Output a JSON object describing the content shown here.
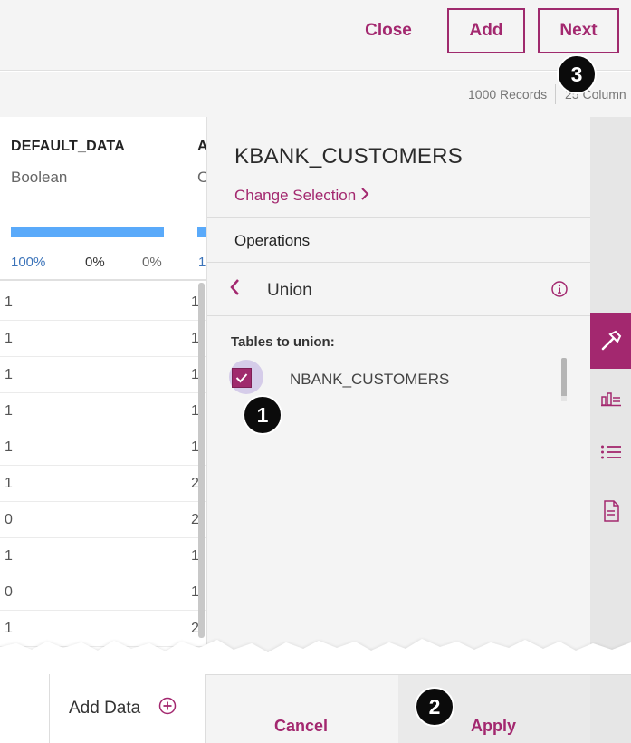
{
  "header": {
    "close_label": "Close",
    "add_label": "Add",
    "next_label": "Next"
  },
  "records_bar": {
    "records": "1000 Records",
    "columns": "25 Column"
  },
  "table": {
    "columns": [
      {
        "name": "DEFAULT_DATA",
        "type": "Boolean"
      },
      {
        "name": "A",
        "type": "C"
      }
    ],
    "stats": [
      "100%",
      "0%",
      "0%",
      "1"
    ],
    "rows": [
      [
        "1",
        "1"
      ],
      [
        "1",
        "1"
      ],
      [
        "1",
        "1"
      ],
      [
        "1",
        "1"
      ],
      [
        "1",
        "1"
      ],
      [
        "1",
        "2"
      ],
      [
        "0",
        "2"
      ],
      [
        "1",
        "1"
      ],
      [
        "0",
        "1"
      ],
      [
        "1",
        "2"
      ]
    ]
  },
  "panel": {
    "title": "KBANK_CUSTOMERS",
    "change_selection": "Change Selection",
    "operations_label": "Operations",
    "operation_name": "Union",
    "tables_label": "Tables to union:",
    "tables": [
      {
        "name": "NBANK_CUSTOMERS",
        "checked": true
      }
    ]
  },
  "sidebar": {
    "icons": [
      "hammer-icon",
      "bar-chart-icon",
      "list-icon",
      "document-icon"
    ],
    "active": "hammer-icon"
  },
  "footer": {
    "add_data_label": "Add Data",
    "cancel_label": "Cancel",
    "apply_label": "Apply"
  },
  "steps": [
    "1",
    "2",
    "3"
  ],
  "colors": {
    "accent": "#a3286f",
    "progress_blue": "#5aaafa",
    "panel_bg": "#f4f4f4"
  }
}
